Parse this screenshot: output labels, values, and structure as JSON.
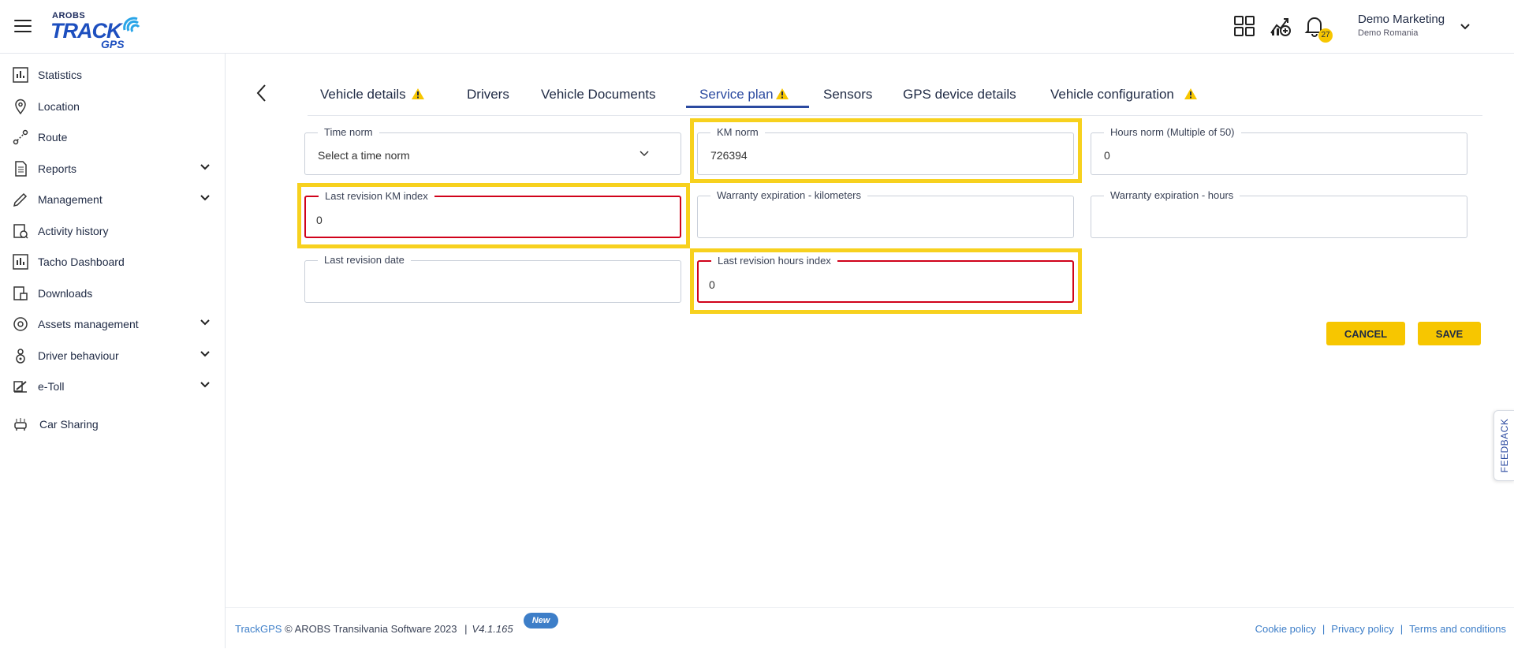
{
  "header": {
    "logo_top": "AROBS",
    "logo_main": "TRACK",
    "logo_sub": "GPS",
    "user_name": "Demo Marketing",
    "user_org": "Demo Romania",
    "notification_count": "27"
  },
  "sidebar": {
    "items": [
      {
        "label": "Statistics",
        "icon": "bar-chart-icon",
        "expandable": false
      },
      {
        "label": "Location",
        "icon": "map-pin-icon",
        "expandable": false
      },
      {
        "label": "Route",
        "icon": "route-icon",
        "expandable": false
      },
      {
        "label": "Reports",
        "icon": "document-icon",
        "expandable": true
      },
      {
        "label": "Management",
        "icon": "pencil-icon",
        "expandable": true
      },
      {
        "label": "Activity history",
        "icon": "history-icon",
        "expandable": false
      },
      {
        "label": "Tacho Dashboard",
        "icon": "tacho-icon",
        "expandable": false
      },
      {
        "label": "Downloads",
        "icon": "download-icon",
        "expandable": false
      },
      {
        "label": "Assets management",
        "icon": "assets-icon",
        "expandable": true
      },
      {
        "label": "Driver behaviour",
        "icon": "driver-icon",
        "expandable": true
      },
      {
        "label": "e-Toll",
        "icon": "etoll-icon",
        "expandable": true
      },
      {
        "label": "Car Sharing",
        "icon": "car-sharing-icon",
        "expandable": false
      }
    ]
  },
  "tabs": [
    {
      "label": "Vehicle details",
      "warning": true
    },
    {
      "label": "Drivers",
      "warning": false
    },
    {
      "label": "Vehicle Documents",
      "warning": false
    },
    {
      "label": "Service plan",
      "warning": true,
      "active": true
    },
    {
      "label": "Sensors",
      "warning": false
    },
    {
      "label": "GPS device details",
      "warning": false
    },
    {
      "label": "Vehicle configuration",
      "warning": true
    }
  ],
  "form": {
    "time_norm": {
      "label": "Time norm",
      "value": "Select a time norm"
    },
    "km_norm": {
      "label": "KM norm",
      "value": "726394"
    },
    "hours_norm": {
      "label": "Hours norm  (Multiple of 50)",
      "value": "0"
    },
    "last_revision_km": {
      "label": "Last revision KM index",
      "value": "0"
    },
    "warranty_km": {
      "label": "Warranty expiration - kilometers",
      "value": ""
    },
    "warranty_hours": {
      "label": "Warranty expiration - hours",
      "value": ""
    },
    "last_revision_date": {
      "label": "Last revision date",
      "value": ""
    },
    "last_revision_hours": {
      "label": "Last revision hours index",
      "value": "0"
    }
  },
  "actions": {
    "cancel": "CANCEL",
    "save": "SAVE"
  },
  "feedback": "FEEDBACK",
  "footer": {
    "brand": "TrackGPS",
    "copyright": "© AROBS Transilvania Software 2023",
    "version": "V4.1.165",
    "new_badge": "New",
    "links": [
      "Cookie policy",
      "Privacy policy",
      "Terms and conditions"
    ]
  },
  "colors": {
    "accent": "#f7c600",
    "primary": "#2b4aa0",
    "error": "#d0021b",
    "highlight": "#f7d11e"
  }
}
